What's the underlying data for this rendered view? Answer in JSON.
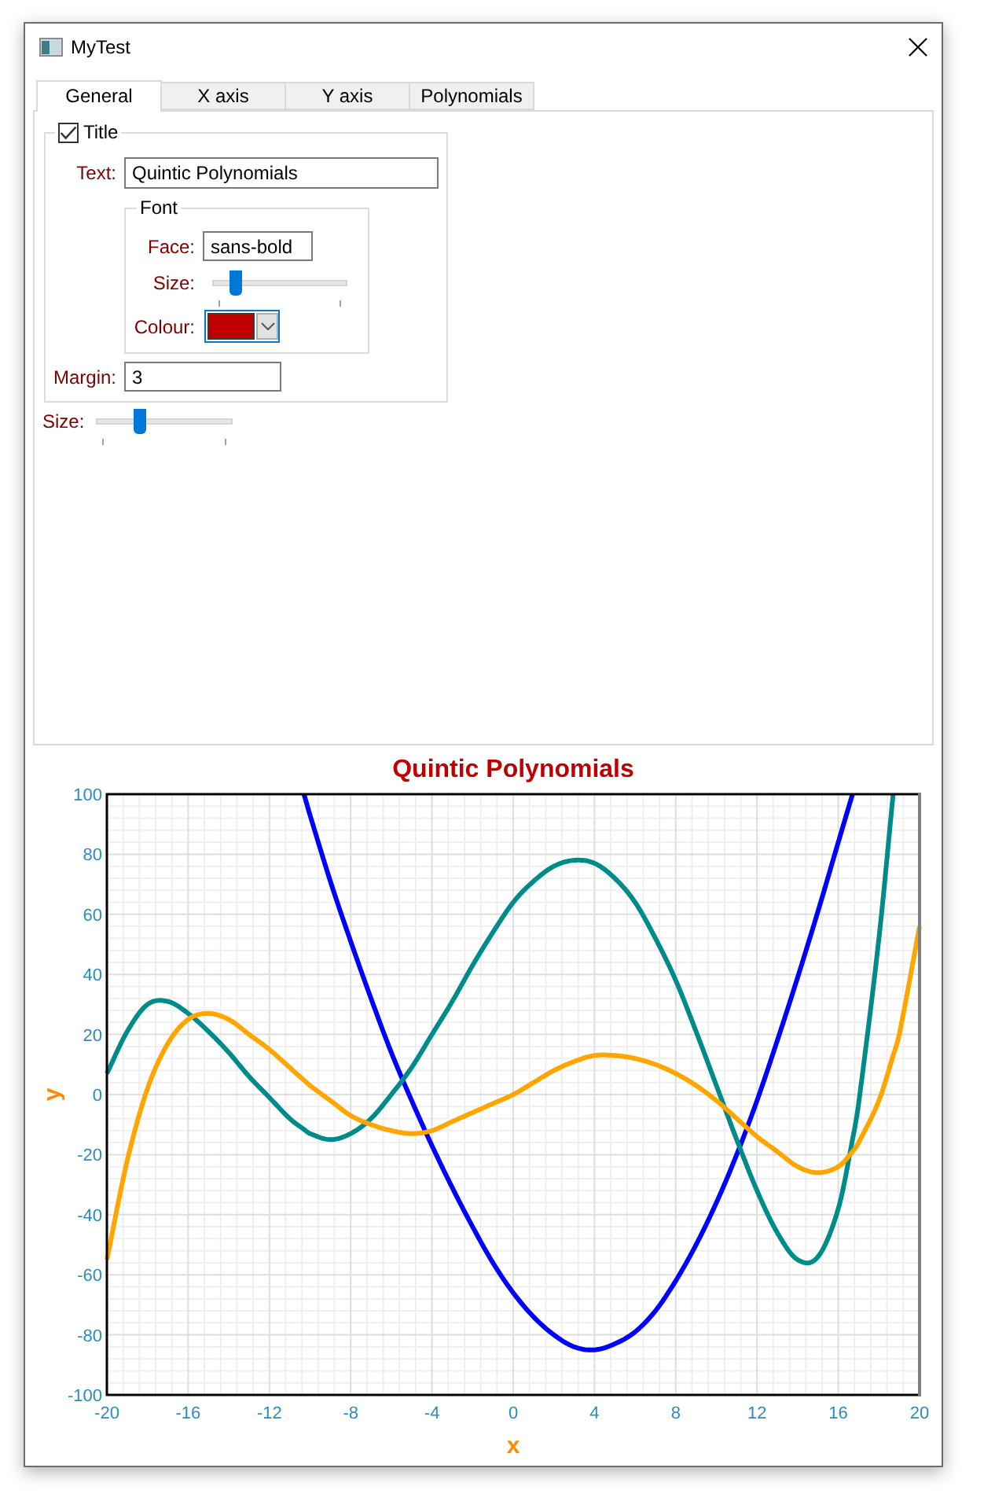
{
  "window": {
    "title": "MyTest"
  },
  "tabs": [
    {
      "label": "General",
      "selected": true
    },
    {
      "label": "X axis",
      "selected": false
    },
    {
      "label": "Y axis",
      "selected": false
    },
    {
      "label": "Polynomials",
      "selected": false
    }
  ],
  "general": {
    "title_group": {
      "label": "Title",
      "checked": true,
      "text": {
        "label": "Text:",
        "value": "Quintic Polynomials"
      },
      "font": {
        "label": "Font",
        "face": {
          "label": "Face:",
          "value": "sans-bold"
        },
        "size": {
          "label": "Size:",
          "level": 0.14
        },
        "colour": {
          "label": "Colour:",
          "color": "#c00000"
        }
      },
      "margin": {
        "label": "Margin:",
        "value": "3"
      }
    },
    "size": {
      "label": "Size:",
      "level": 0.31
    }
  },
  "chart": {
    "chart_data": {
      "type": "line",
      "title": "Quintic Polynomials",
      "xlabel": "x",
      "ylabel": "y",
      "grid": true,
      "x": [
        -20,
        -19,
        -18,
        -17,
        -16,
        -15,
        -14,
        -13,
        -12,
        -11,
        -10.3,
        -10,
        -9,
        -8,
        -7,
        -6,
        -5,
        -4,
        -3,
        -2,
        -1,
        0,
        1,
        2,
        3,
        4,
        5,
        6,
        7,
        8,
        9,
        10,
        11,
        12,
        13,
        14,
        15,
        16,
        16.7,
        17,
        18,
        18.7,
        19,
        20
      ],
      "series": [
        {
          "color": "#0000ff",
          "values": [
            null,
            null,
            null,
            null,
            null,
            null,
            null,
            null,
            null,
            null,
            100,
            93,
            71,
            51,
            32,
            14,
            -2,
            -17,
            -31,
            -44,
            -56,
            -66,
            -74,
            -80,
            -84,
            -85,
            -83,
            -79,
            -72,
            -62,
            -50,
            -36,
            -20,
            -2,
            18,
            39,
            61,
            84,
            100,
            null,
            null,
            null,
            null,
            null
          ]
        },
        {
          "color": "#008b8b",
          "values": [
            7,
            21,
            30,
            31,
            27,
            21,
            14,
            6,
            -1,
            -8,
            -11.6,
            -13,
            -15,
            -13,
            -8,
            0,
            9,
            20,
            31,
            43,
            54,
            64,
            71,
            76,
            78,
            77,
            72,
            64,
            52,
            38,
            21,
            3,
            -15,
            -32,
            -46,
            -55,
            -54,
            -38,
            -15,
            -3,
            52,
            100,
            null,
            null
          ]
        },
        {
          "color": "#ffa500",
          "values": [
            -55,
            -22,
            2,
            17,
            25,
            27,
            25,
            20,
            15,
            9,
            4.8,
            3,
            -2,
            -7,
            -10,
            -12,
            -13,
            -12,
            -9,
            -6,
            -3,
            0,
            4,
            8,
            11,
            13,
            13,
            12,
            10,
            7,
            3,
            -2,
            -8,
            -14,
            -19,
            -24,
            -26,
            -24,
            -19,
            -16,
            -2,
            13,
            20,
            56
          ]
        }
      ],
      "xlim": [
        -20,
        20
      ],
      "ylim": [
        -100,
        100
      ],
      "xticks": [
        -20,
        -16,
        -12,
        -8,
        -4,
        0,
        4,
        8,
        12,
        16,
        20
      ],
      "yticks": [
        -100,
        -80,
        -60,
        -40,
        -20,
        0,
        20,
        40,
        60,
        80,
        100
      ]
    }
  }
}
